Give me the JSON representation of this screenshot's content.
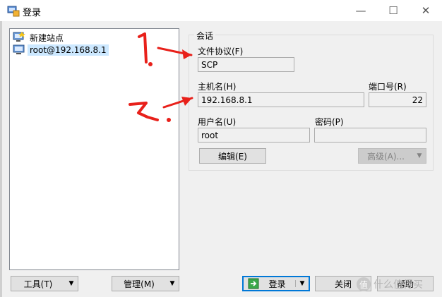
{
  "window": {
    "title": "登录",
    "minimize_glyph": "—",
    "maximize_glyph": "☐",
    "close_glyph": "✕"
  },
  "tree": {
    "items": [
      {
        "label": "新建站点",
        "icon": "new-site-icon"
      },
      {
        "label": "root@192.168.8.1",
        "icon": "computer-icon",
        "selected": true
      }
    ]
  },
  "session": {
    "group_title": "会话",
    "protocol_label": "文件协议(F)",
    "protocol_value": "SCP",
    "host_label": "主机名(H)",
    "host_value": "192.168.8.1",
    "port_label": "端口号(R)",
    "port_value": "22",
    "user_label": "用户名(U)",
    "user_value": "root",
    "password_label": "密码(P)",
    "password_value": "",
    "edit_button": "编辑(E)",
    "advanced_button": "高级(A)...",
    "dropdown_glyph": "▼"
  },
  "bottom": {
    "tools_button": "工具(T)",
    "manage_button": "管理(M)",
    "login_button": "登录",
    "close_button": "关闭",
    "help_button": "帮助"
  },
  "annotations": {
    "mark1": "1.",
    "mark2": "2.",
    "color": "#e8201a"
  },
  "watermark": {
    "text": "什么值得买",
    "badge": "值"
  }
}
